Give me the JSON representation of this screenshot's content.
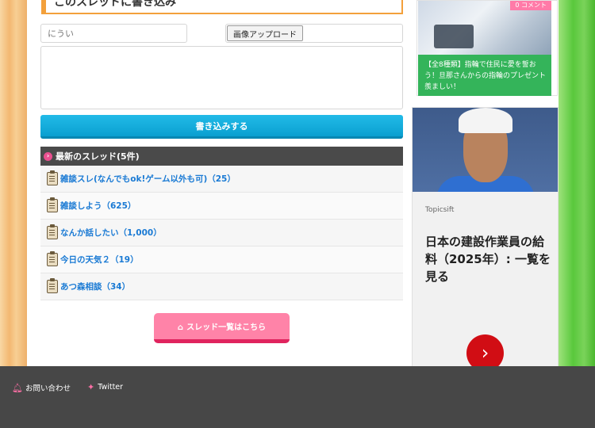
{
  "form": {
    "heading": "このスレッドに書き込み",
    "name_placeholder": "にうい",
    "upload_label": "画像アップロード",
    "submit_label": "書き込みする"
  },
  "latest": {
    "title": "最新のスレッド(5件)",
    "threads": [
      {
        "label": "雑談スレ(なんでもok!ゲーム以外も可)（25）"
      },
      {
        "label": "雑談しよう（625）"
      },
      {
        "label": "なんか話したい（1,000）"
      },
      {
        "label": "今日の天気２（19）"
      },
      {
        "label": "あつ森相談（34）"
      }
    ],
    "list_button": "スレッド一覧はこちら"
  },
  "sidebar": {
    "card": {
      "badge": "0 コメント",
      "text": "【全8種類】指輪で住民に愛を誓おう！旦那さんからの指輪のプレゼント羨ましい！"
    },
    "ad": {
      "source": "Topicsift",
      "headline": "日本の建設作業員の給料（2025年）: 一覧を見る"
    }
  },
  "footer": {
    "contact": "お問い合わせ",
    "twitter": "Twitter"
  },
  "colors": {
    "accent_orange": "#f3a03b",
    "submit_blue": "#0a9fd0",
    "list_pink": "#ff83a8",
    "card_green": "#34b45a",
    "ad_red": "#d10d14",
    "footer_gray": "#474747"
  },
  "icons": {
    "thread": "clipboard-icon",
    "header": "circle-arrow-icon",
    "list_button": "home-icon",
    "contact": "bell-icon",
    "twitter": "twitter-bird-icon",
    "ad_cta": "chevron-right-icon"
  }
}
